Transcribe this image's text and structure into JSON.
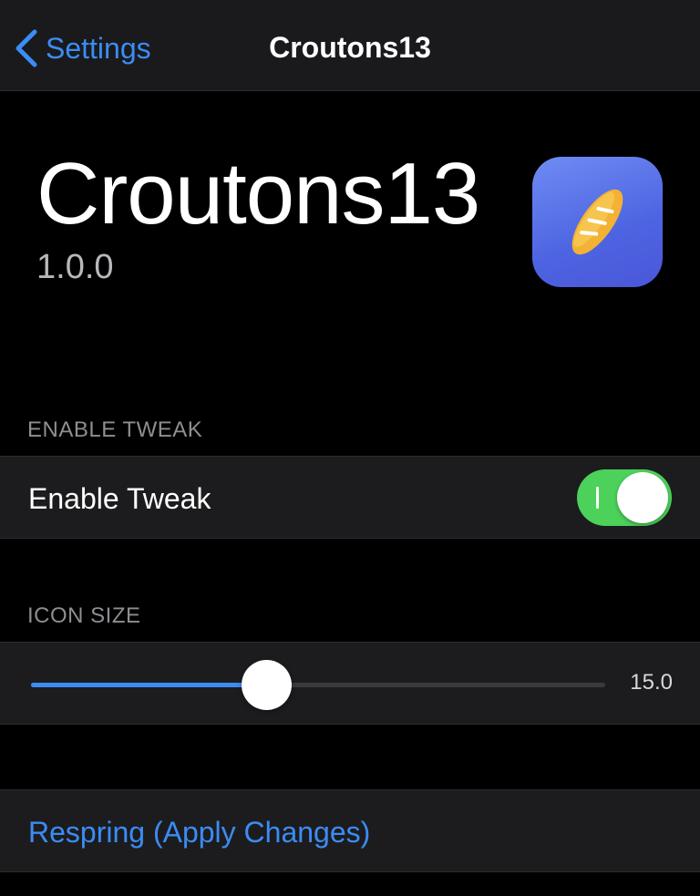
{
  "nav": {
    "back_label": "Settings",
    "title": "Croutons13"
  },
  "header": {
    "title": "Croutons13",
    "version": "1.0.0",
    "icon": "bread-icon"
  },
  "sections": {
    "enable": {
      "header": "ENABLE TWEAK",
      "label": "Enable Tweak",
      "toggle_on": true
    },
    "icon_size": {
      "header": "ICON SIZE",
      "value_label": "15.0",
      "fraction": 0.41
    },
    "respring": {
      "label": "Respring (Apply Changes)"
    }
  },
  "colors": {
    "accent": "#3b8cf4",
    "toggle_on": "#4cd15a",
    "cell_bg": "#1c1c1e",
    "background": "#000000"
  }
}
